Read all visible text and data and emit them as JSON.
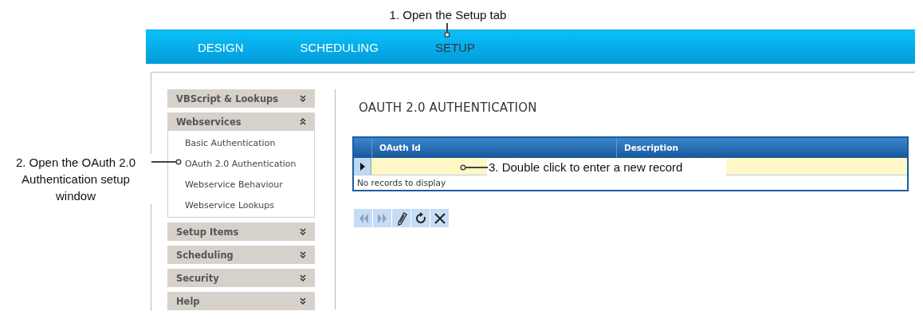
{
  "nav": {
    "tabs": [
      {
        "label": "DESIGN",
        "selected": false
      },
      {
        "label": "SCHEDULING",
        "selected": false
      },
      {
        "label": "SETUP",
        "selected": true
      }
    ]
  },
  "sidebar": {
    "sections": [
      {
        "title": "VBScript & Lookups",
        "expanded": false
      },
      {
        "title": "Webservices",
        "expanded": true,
        "items": [
          "Basic Authentication",
          "OAuth 2.0 Authentication",
          "Webservice Behaviour",
          "Webservice Lookups"
        ]
      },
      {
        "title": "Setup Items",
        "expanded": false
      },
      {
        "title": "Scheduling",
        "expanded": false
      },
      {
        "title": "Security",
        "expanded": false
      },
      {
        "title": "Help",
        "expanded": false
      }
    ]
  },
  "page_title": "OAUTH 2.0 AUTHENTICATION",
  "grid": {
    "columns": [
      "OAuth Id",
      "Description"
    ],
    "footer": "No records to display"
  },
  "toolbar": [
    {
      "kind": "first",
      "disabled": true
    },
    {
      "kind": "next",
      "disabled": true
    },
    {
      "kind": "edit",
      "disabled": false
    },
    {
      "kind": "refresh",
      "disabled": false
    },
    {
      "kind": "delete",
      "disabled": false
    }
  ],
  "callouts": [
    "1. Open the Setup tab",
    "2. Open the OAuth 2.0 Authentication setup window",
    "3. Double click to enter a new record"
  ]
}
